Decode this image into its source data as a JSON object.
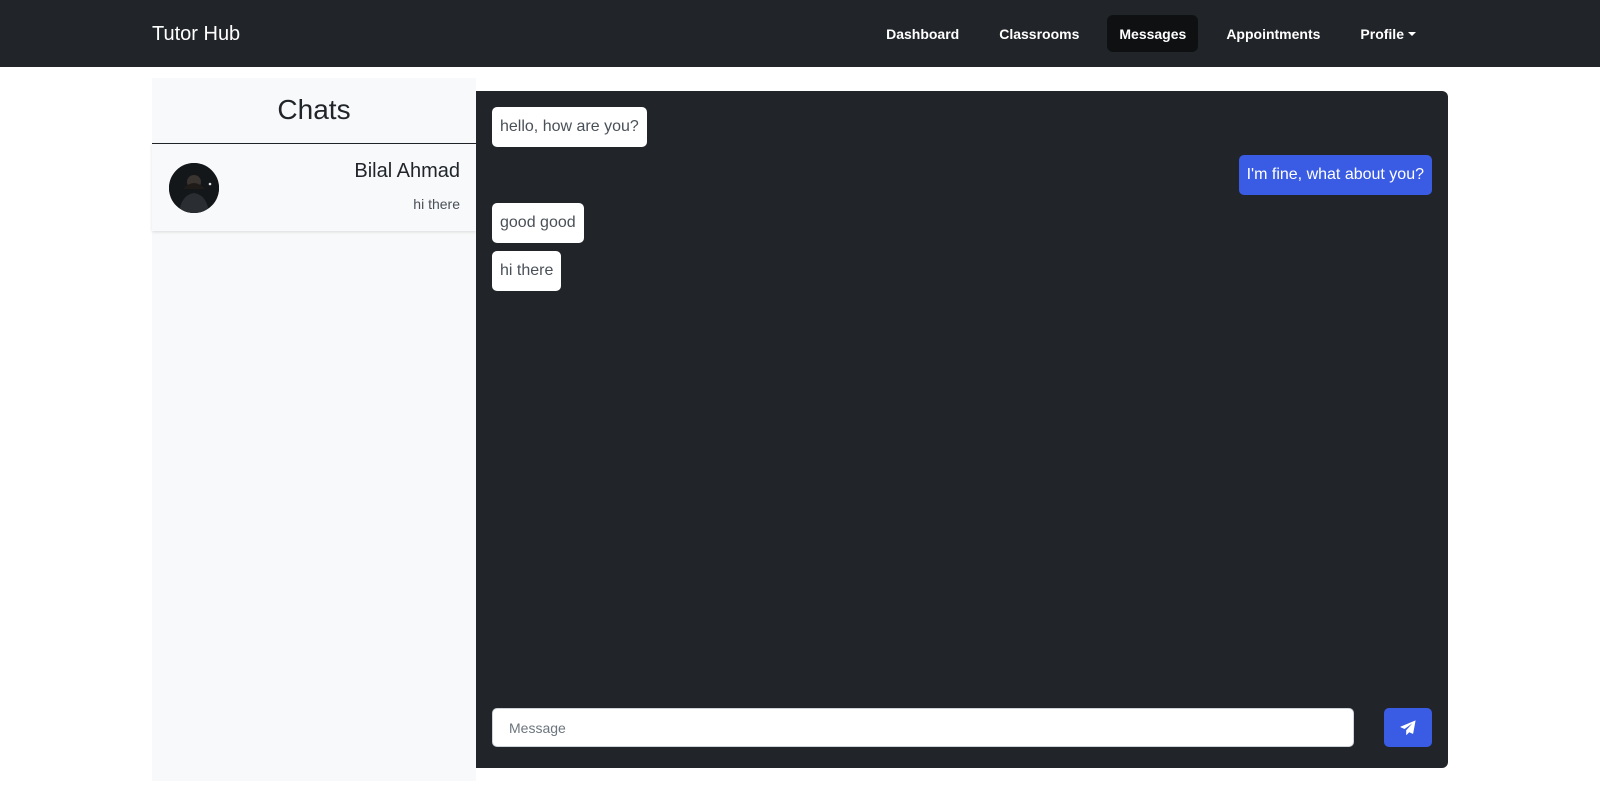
{
  "navbar": {
    "brand": "Tutor Hub",
    "links": [
      {
        "label": "Dashboard"
      },
      {
        "label": "Classrooms"
      },
      {
        "label": "Messages",
        "active": true
      },
      {
        "label": "Appointments"
      },
      {
        "label": "Profile",
        "icon": "caret-down-icon"
      }
    ]
  },
  "sidebar": {
    "title": "Chats",
    "chats": [
      {
        "name": "Bilal Ahmad",
        "preview": "hi there",
        "avatar": "avatar-photo"
      }
    ]
  },
  "conversation": {
    "messages": [
      {
        "text": "hello, how are you?",
        "direction": "incoming"
      },
      {
        "text": "I'm fine, what about you?",
        "direction": "outgoing"
      },
      {
        "text": "good good",
        "direction": "incoming"
      },
      {
        "text": "hi there",
        "direction": "incoming"
      }
    ]
  },
  "composer": {
    "placeholder": "Message",
    "value": "",
    "send_icon": "paper-plane-icon"
  },
  "colors": {
    "navbar_bg": "#212529",
    "chat_bg": "#212529",
    "accent": "#3a5ce4",
    "sidebar_bg": "#f8f9fa"
  }
}
